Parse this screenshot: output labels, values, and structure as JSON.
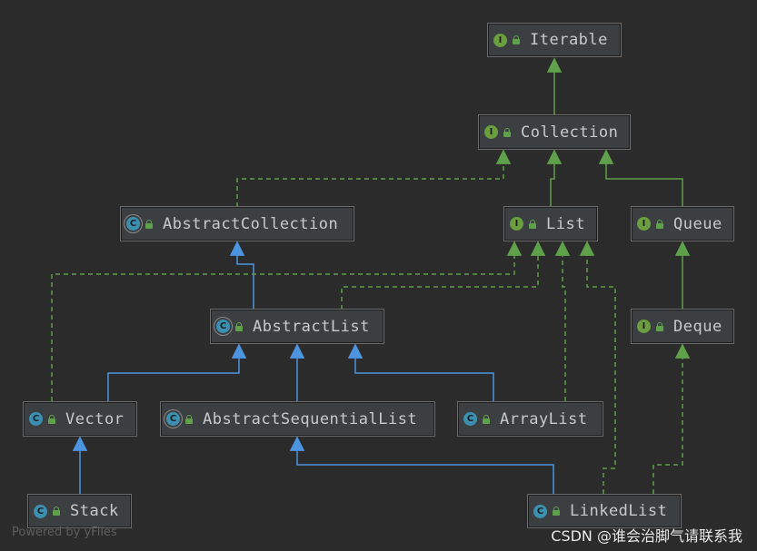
{
  "nodes": {
    "iterable": {
      "label": "Iterable",
      "kind": "interface",
      "badge": "I"
    },
    "collection": {
      "label": "Collection",
      "kind": "interface",
      "badge": "I"
    },
    "abstract_collection": {
      "label": "AbstractCollection",
      "kind": "abstract",
      "badge": "C"
    },
    "list": {
      "label": "List",
      "kind": "interface",
      "badge": "I"
    },
    "queue": {
      "label": "Queue",
      "kind": "interface",
      "badge": "I"
    },
    "abstract_list": {
      "label": "AbstractList",
      "kind": "abstract",
      "badge": "C"
    },
    "deque": {
      "label": "Deque",
      "kind": "interface",
      "badge": "I"
    },
    "vector": {
      "label": "Vector",
      "kind": "class",
      "badge": "C"
    },
    "abstract_sequential_list": {
      "label": "AbstractSequentialList",
      "kind": "abstract",
      "badge": "C"
    },
    "array_list": {
      "label": "ArrayList",
      "kind": "class",
      "badge": "C"
    },
    "stack": {
      "label": "Stack",
      "kind": "class",
      "badge": "C"
    },
    "linked_list": {
      "label": "LinkedList",
      "kind": "class",
      "badge": "C"
    }
  },
  "edges": [
    {
      "from": "collection",
      "to": "iterable",
      "type": "extends-interface"
    },
    {
      "from": "abstract_collection",
      "to": "collection",
      "type": "implements"
    },
    {
      "from": "list",
      "to": "collection",
      "type": "extends-interface"
    },
    {
      "from": "queue",
      "to": "collection",
      "type": "extends-interface"
    },
    {
      "from": "abstract_list",
      "to": "abstract_collection",
      "type": "extends-class"
    },
    {
      "from": "abstract_list",
      "to": "list",
      "type": "implements"
    },
    {
      "from": "vector",
      "to": "list",
      "type": "implements"
    },
    {
      "from": "array_list",
      "to": "list",
      "type": "implements"
    },
    {
      "from": "linked_list",
      "to": "list",
      "type": "implements"
    },
    {
      "from": "deque",
      "to": "queue",
      "type": "extends-interface"
    },
    {
      "from": "vector",
      "to": "abstract_list",
      "type": "extends-class"
    },
    {
      "from": "abstract_sequential_list",
      "to": "abstract_list",
      "type": "extends-class"
    },
    {
      "from": "array_list",
      "to": "abstract_list",
      "type": "extends-class"
    },
    {
      "from": "stack",
      "to": "vector",
      "type": "extends-class"
    },
    {
      "from": "linked_list",
      "to": "abstract_sequential_list",
      "type": "extends-class"
    },
    {
      "from": "linked_list",
      "to": "deque",
      "type": "implements"
    }
  ],
  "colors": {
    "background": "#2b2b2b",
    "node_fill": "#3c3f41",
    "interface_edge": "#5fa04a",
    "class_edge": "#4d94e0",
    "interface_icon": "#6a9e3f",
    "class_icon": "#3b8fb0"
  },
  "watermarks": {
    "left": "Powered by yFiles",
    "right": "CSDN @谁会治脚气请联系我"
  }
}
